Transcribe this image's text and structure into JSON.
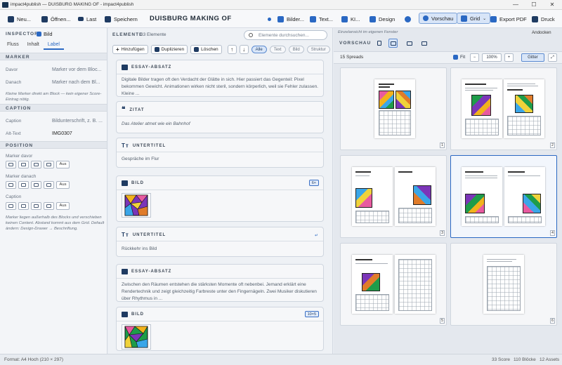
{
  "window": {
    "title": "impact4publish — DUISBURG MAKING OF - impact4publish",
    "min": "—",
    "max": "☐",
    "close": "✕"
  },
  "toolbar": {
    "new": "Neu...",
    "open": "Öffnen...",
    "last": "Last",
    "save": "Speichern",
    "doc_title": "DUISBURG MAKING OF",
    "images": "Bilder...",
    "text": "Text...",
    "ki": "KI...",
    "design": "Design",
    "preview": "Vorschau",
    "grid": "Grid",
    "export_pdf": "Export PDF",
    "print": "Druck"
  },
  "inspector": {
    "heading": "INSPECTOR",
    "selected": "Bild",
    "tabs": [
      "Fluss",
      "Inhalt",
      "Label"
    ],
    "active_tab": "Label",
    "marker": {
      "section": "MARKER",
      "before_label": "Davor",
      "before_value": "Marker vor dem Bloc...",
      "after_label": "Danach",
      "after_value": "Marker nach dem Bl...",
      "note": "Kleine Marker direkt am Block — kein eigener Score-Eintrag nötig."
    },
    "caption": {
      "section": "CAPTION",
      "caption_label": "Caption",
      "caption_value": "Bildunterschrift, z. B. ...",
      "alt_label": "Alt-Text",
      "alt_value": "IMG0307"
    },
    "position": {
      "section": "POSITION",
      "before_label": "Marker davor",
      "after_label": "Marker danach",
      "caption_label": "Caption",
      "off": "Aus",
      "note": "Marker liegen außerhalb des Blocks und verschieben keinen Content. Abstand kommt aus dem Grid. Default ändern: Design-Drawer → Beschriftung."
    }
  },
  "elements": {
    "heading": "ELEMENTE",
    "count": "33 Elemente",
    "search_placeholder": "Elemente durchsuchen...",
    "add": "Hinzufügen",
    "duplicate": "Duplizieren",
    "delete": "Löschen",
    "filters": [
      "Alle",
      "Text",
      "Bild",
      "Struktur"
    ],
    "cards": [
      {
        "type": "ESSAY-ABSATZ",
        "text": "Digitale Bilder tragen oft den Verdacht der Glätte in sich. Hier passiert das Gegenteil: Pixel bekommen Gewicht. Animationen wirken nicht steril, sondern körperlich, weil sie Fehler zulassen. Kleine ..."
      },
      {
        "type": "ZITAT",
        "text": "Das Atelier atmet wie ein Bahnhof"
      },
      {
        "type": "UNTERTITEL",
        "text": "Gespräche im Flur"
      },
      {
        "type": "BILD",
        "badge": "6×"
      },
      {
        "type": "UNTERTITEL",
        "text": "Rückkehr ins Bild"
      },
      {
        "type": "ESSAY-ABSATZ",
        "text": "Zwischen den Räumen entstehen die stärksten Momente oft nebenbei. Jemand erklärt eine Rendertechnik und zeigt gleichzeitig Farbreste unter den Fingernägeln. Zwei Musiker diskutieren über Rhythmus in ..."
      },
      {
        "type": "BILD",
        "badge": "10×5"
      }
    ]
  },
  "preview": {
    "hint": "Einzelansicht im eigenen Fenster",
    "dock": "Andocken",
    "heading": "VORSCHAU",
    "spreads": "15 Spreads",
    "fit": "Fit",
    "zoom": "100%",
    "grid_btn": "Gitter",
    "page_titles": [
      "GRENZLAUF MIT FARBE UND PIXEL",
      "WAS HAT DAS MIT DER STADT ZU TUN?",
      "ATELIER IM FLUR",
      "ZWISCHENSTAND",
      "RÜCKKEHR INS BILD"
    ],
    "pages": [
      "1",
      "2",
      "3",
      "4",
      "5",
      "6"
    ]
  },
  "status": {
    "format": "Format: A4 Hoch (210 × 297)",
    "score": "33 Score",
    "blocks": "110 Blöcke",
    "assets": "12 Assets"
  }
}
